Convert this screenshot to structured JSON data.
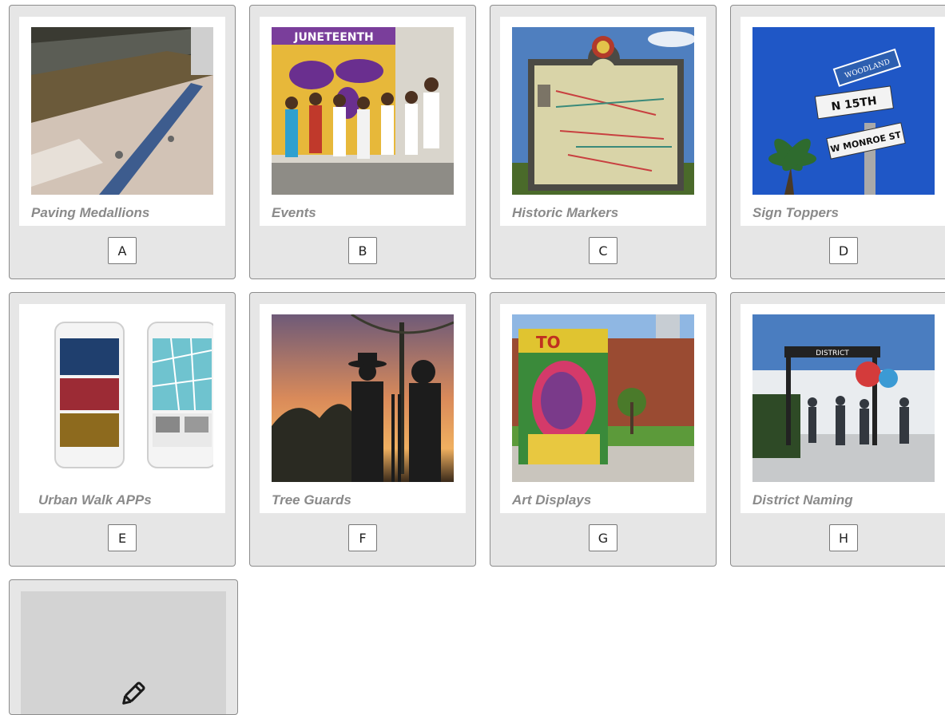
{
  "cards": [
    {
      "caption": "Paving Medallions",
      "letter": "A"
    },
    {
      "caption": "Events",
      "letter": "B"
    },
    {
      "caption": "Historic Markers",
      "letter": "C"
    },
    {
      "caption": "Sign Toppers",
      "letter": "D"
    },
    {
      "caption": "Urban Walk APPs",
      "letter": "E"
    },
    {
      "caption": "Tree Guards",
      "letter": "F"
    },
    {
      "caption": "Art Displays",
      "letter": "G"
    },
    {
      "caption": "District Naming",
      "letter": "H"
    }
  ],
  "photo_text": {
    "events_banner": "JUNETEENTH",
    "sign_top": "WOODLAND",
    "sign_mid": "N 15TH",
    "sign_bottom": "W MONROE ST",
    "art_banner": "TO",
    "district_gate": "DISTRICT"
  },
  "add_card": {
    "icon": "pencil-icon"
  }
}
